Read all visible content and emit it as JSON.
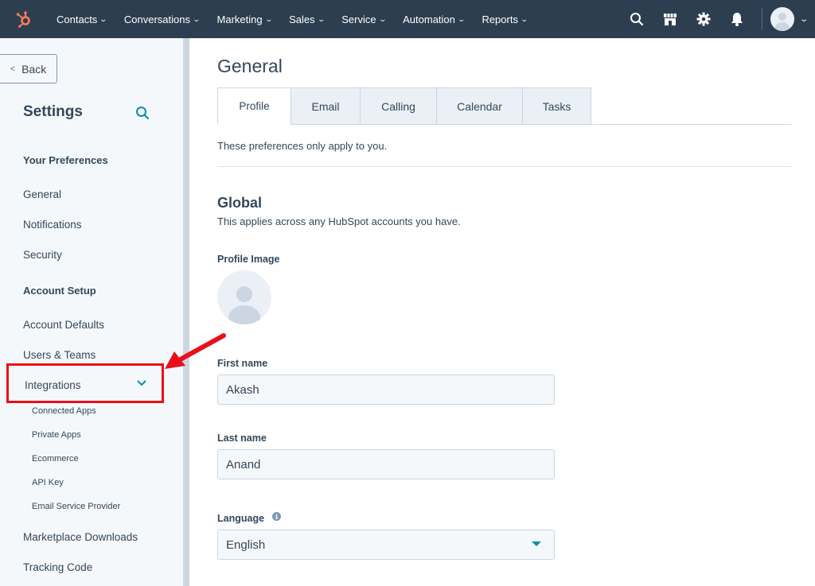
{
  "topnav": {
    "logo_icon": "hubspot-sprocket-icon",
    "brand_color": "#ff7a59",
    "bg_color": "#2d3e50",
    "items": [
      {
        "label": "Contacts"
      },
      {
        "label": "Conversations"
      },
      {
        "label": "Marketing"
      },
      {
        "label": "Sales"
      },
      {
        "label": "Service"
      },
      {
        "label": "Automation"
      },
      {
        "label": "Reports"
      }
    ],
    "icons": [
      "search-icon",
      "marketplace-icon",
      "gear-icon",
      "bell-icon",
      "avatar"
    ]
  },
  "sidebar": {
    "back_label": "Back",
    "title": "Settings",
    "sections": {
      "preferences": "Your Preferences",
      "account_setup": "Account Setup"
    },
    "pref_items": [
      {
        "label": "General"
      },
      {
        "label": "Notifications"
      },
      {
        "label": "Security"
      }
    ],
    "account_items": [
      {
        "label": "Account Defaults"
      },
      {
        "label": "Users & Teams"
      }
    ],
    "integrations": {
      "label": "Integrations",
      "children": [
        {
          "label": "Connected Apps"
        },
        {
          "label": "Private Apps"
        },
        {
          "label": "Ecommerce"
        },
        {
          "label": "API Key"
        },
        {
          "label": "Email Service Provider"
        }
      ]
    },
    "more_items": [
      {
        "label": "Marketplace Downloads"
      },
      {
        "label": "Tracking Code"
      }
    ],
    "highlight_color": "#e8101a"
  },
  "main": {
    "page_title": "General",
    "tabs": [
      {
        "label": "Profile",
        "active": true
      },
      {
        "label": "Email"
      },
      {
        "label": "Calling"
      },
      {
        "label": "Calendar"
      },
      {
        "label": "Tasks"
      }
    ],
    "pref_note": "These preferences only apply to you.",
    "global_title": "Global",
    "global_sub": "This applies across any HubSpot accounts you have.",
    "profile_image_label": "Profile Image",
    "first_name_label": "First name",
    "first_name_value": "Akash",
    "last_name_label": "Last name",
    "last_name_value": "Anand",
    "language_label": "Language",
    "language_value": "English",
    "accent_color": "#0091ae"
  }
}
